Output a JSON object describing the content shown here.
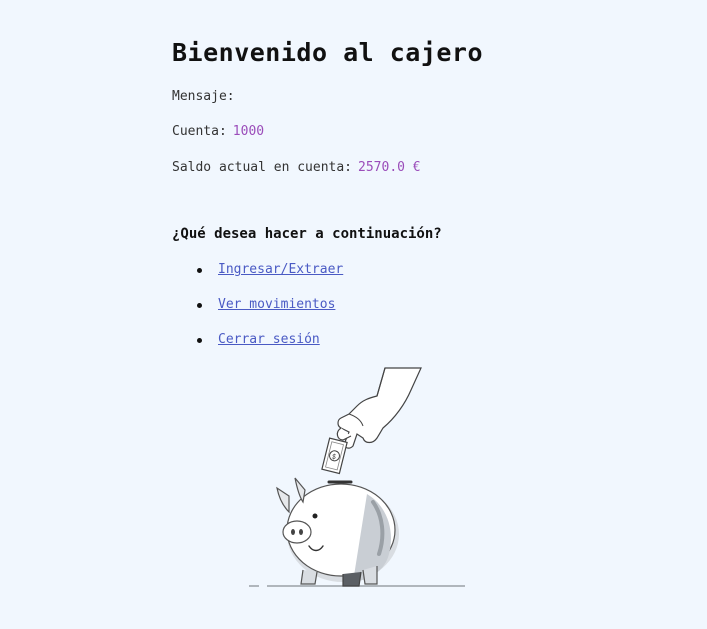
{
  "page": {
    "title": "Bienvenido al cajero"
  },
  "info": {
    "message_label": "Mensaje:",
    "message_value": "",
    "account_label": "Cuenta:",
    "account_value": "1000",
    "balance_label": "Saldo actual en cuenta:",
    "balance_value": "2570.0 €"
  },
  "menu": {
    "heading": "¿Qué desea hacer a continuación?",
    "items": [
      {
        "label": "Ingresar/Extraer"
      },
      {
        "label": "Ver movimientos"
      },
      {
        "label": "Cerrar sesión"
      }
    ]
  },
  "colors": {
    "background": "#f1f7fe",
    "value_accent": "#9b4dba",
    "link": "#4a5ac4"
  },
  "illustration": {
    "icon": "piggy-bank-coin-hand-icon"
  }
}
